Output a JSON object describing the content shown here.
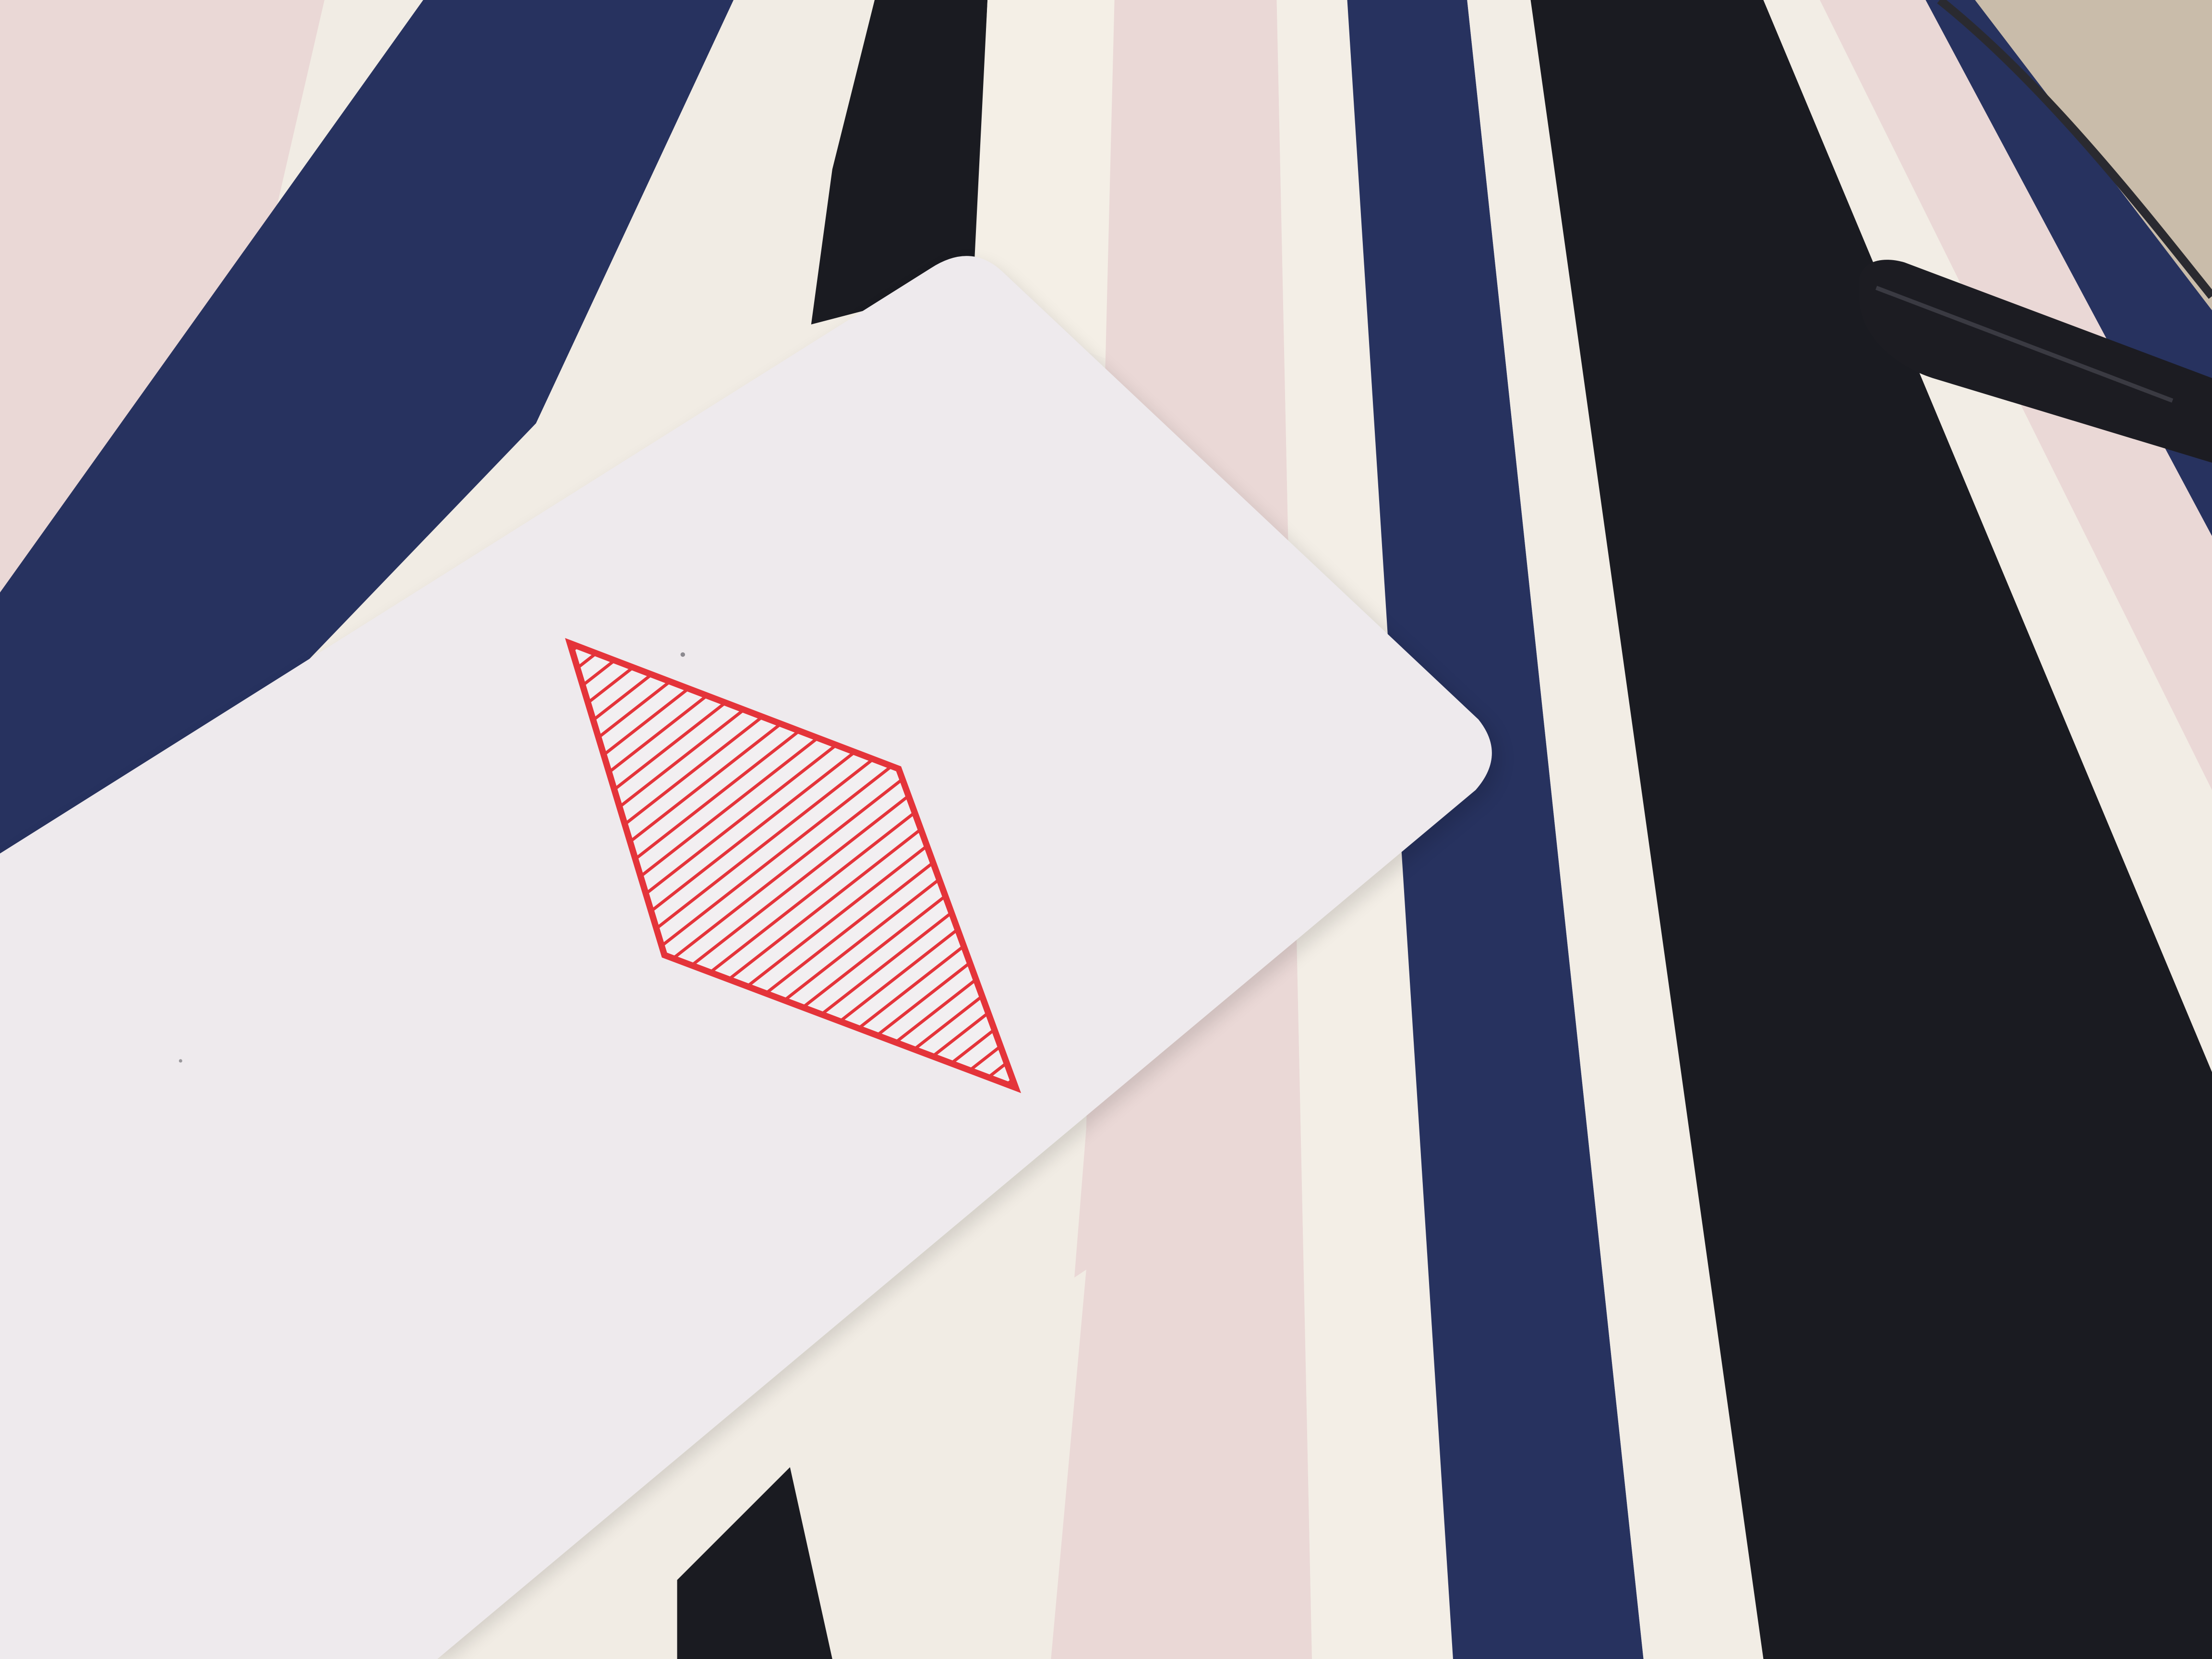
{
  "scene": {
    "kind": "photo",
    "subject": "playing-card-with-diamond-on-striped-fabric",
    "colors": {
      "pink": "#ead8d6",
      "cream": "#f1ece4",
      "navy": "#27325f",
      "black": "#1a1b21",
      "card": "#f2eff1",
      "card_shadow": "#d9d4d6",
      "diamond_red": "#e4343a",
      "carpet": "#c9bcaa",
      "tab": "#1c1c22"
    },
    "icons": {
      "card_symbol": "diamond-suit-icon"
    }
  }
}
